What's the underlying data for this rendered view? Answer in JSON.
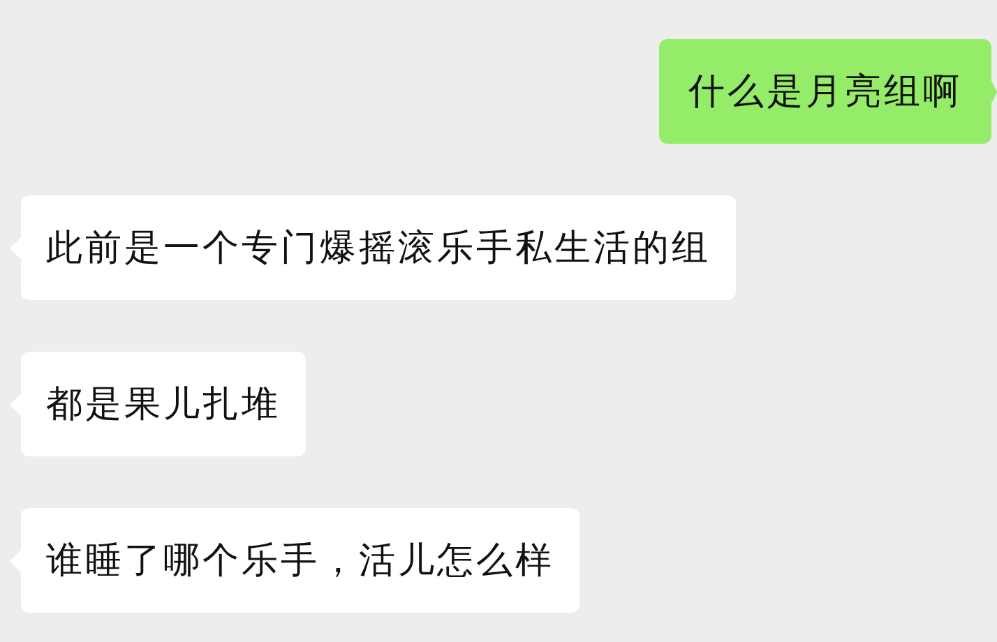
{
  "messages": [
    {
      "kind": "sent",
      "text": "什么是月亮组啊"
    },
    {
      "kind": "received",
      "text": "此前是一个专门爆摇滚乐手私生活的组"
    },
    {
      "kind": "received",
      "text": "都是果儿扎堆"
    },
    {
      "kind": "received",
      "text": "谁睡了哪个乐手，活儿怎么样"
    }
  ]
}
